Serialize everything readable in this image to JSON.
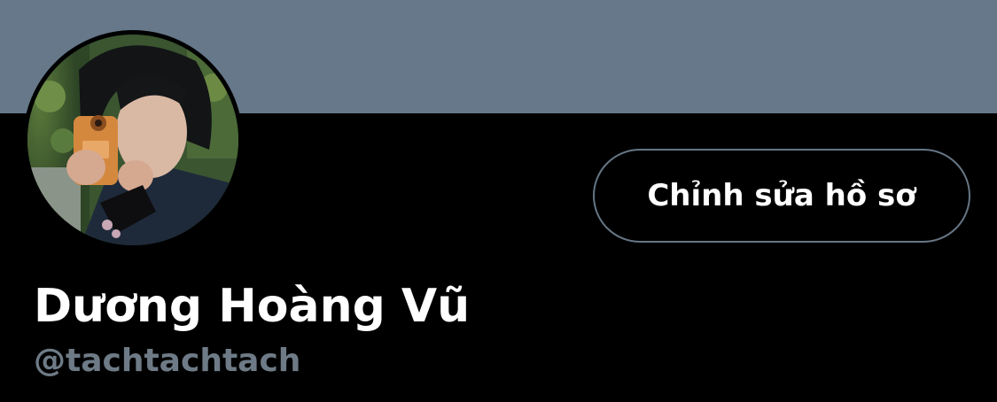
{
  "profile": {
    "display_name": "Dương Hoàng Vũ",
    "handle": "@tachtachtach",
    "edit_button_label": "Chỉnh sửa hồ sơ"
  },
  "colors": {
    "banner": "#66788a",
    "background": "#000000",
    "handle_text": "#6e7b87",
    "button_border": "#657685",
    "text_primary": "#ffffff"
  }
}
